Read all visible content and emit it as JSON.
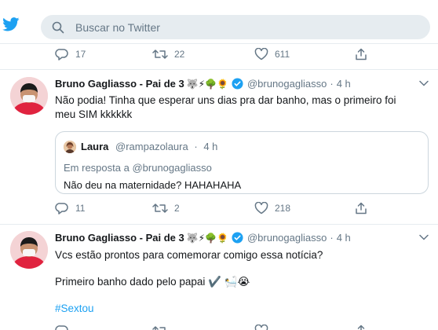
{
  "header": {
    "search_placeholder": "Buscar no Twitter",
    "brand_color": "#1da1f2"
  },
  "tweet0": {
    "replies": "17",
    "retweets": "22",
    "likes": "611"
  },
  "tweet1": {
    "name": "Bruno Gagliasso - Pai de 3",
    "emojis": "🐺⚡🌳🌻",
    "handle": "@brunogagliasso",
    "sep": "·",
    "time": "4 h",
    "text_line1": "Não podia! Tinha que esperar uns dias pra dar banho, mas o primeiro foi",
    "text_line2": "meu SIM kkkkkk",
    "quote": {
      "name": "Laura",
      "handle": "@rampazolaura",
      "sep": "·",
      "time": "4 h",
      "reply_prefix": "Em resposta a",
      "reply_handle": "@brunogagliasso",
      "text": "Não deu na maternidade? HAHAHAHA"
    },
    "replies": "11",
    "retweets": "2",
    "likes": "218"
  },
  "tweet2": {
    "name": "Bruno Gagliasso - Pai de 3",
    "emojis": "🐺⚡🌳🌻",
    "handle": "@brunogagliasso",
    "sep": "·",
    "time": "4 h",
    "text_line1": "Vcs estão prontos para comemorar comigo essa notícia?",
    "text_line2": "Primeiro banho dado pelo papai ✔️ 🛀😭",
    "hashtag": "#Sextou"
  }
}
